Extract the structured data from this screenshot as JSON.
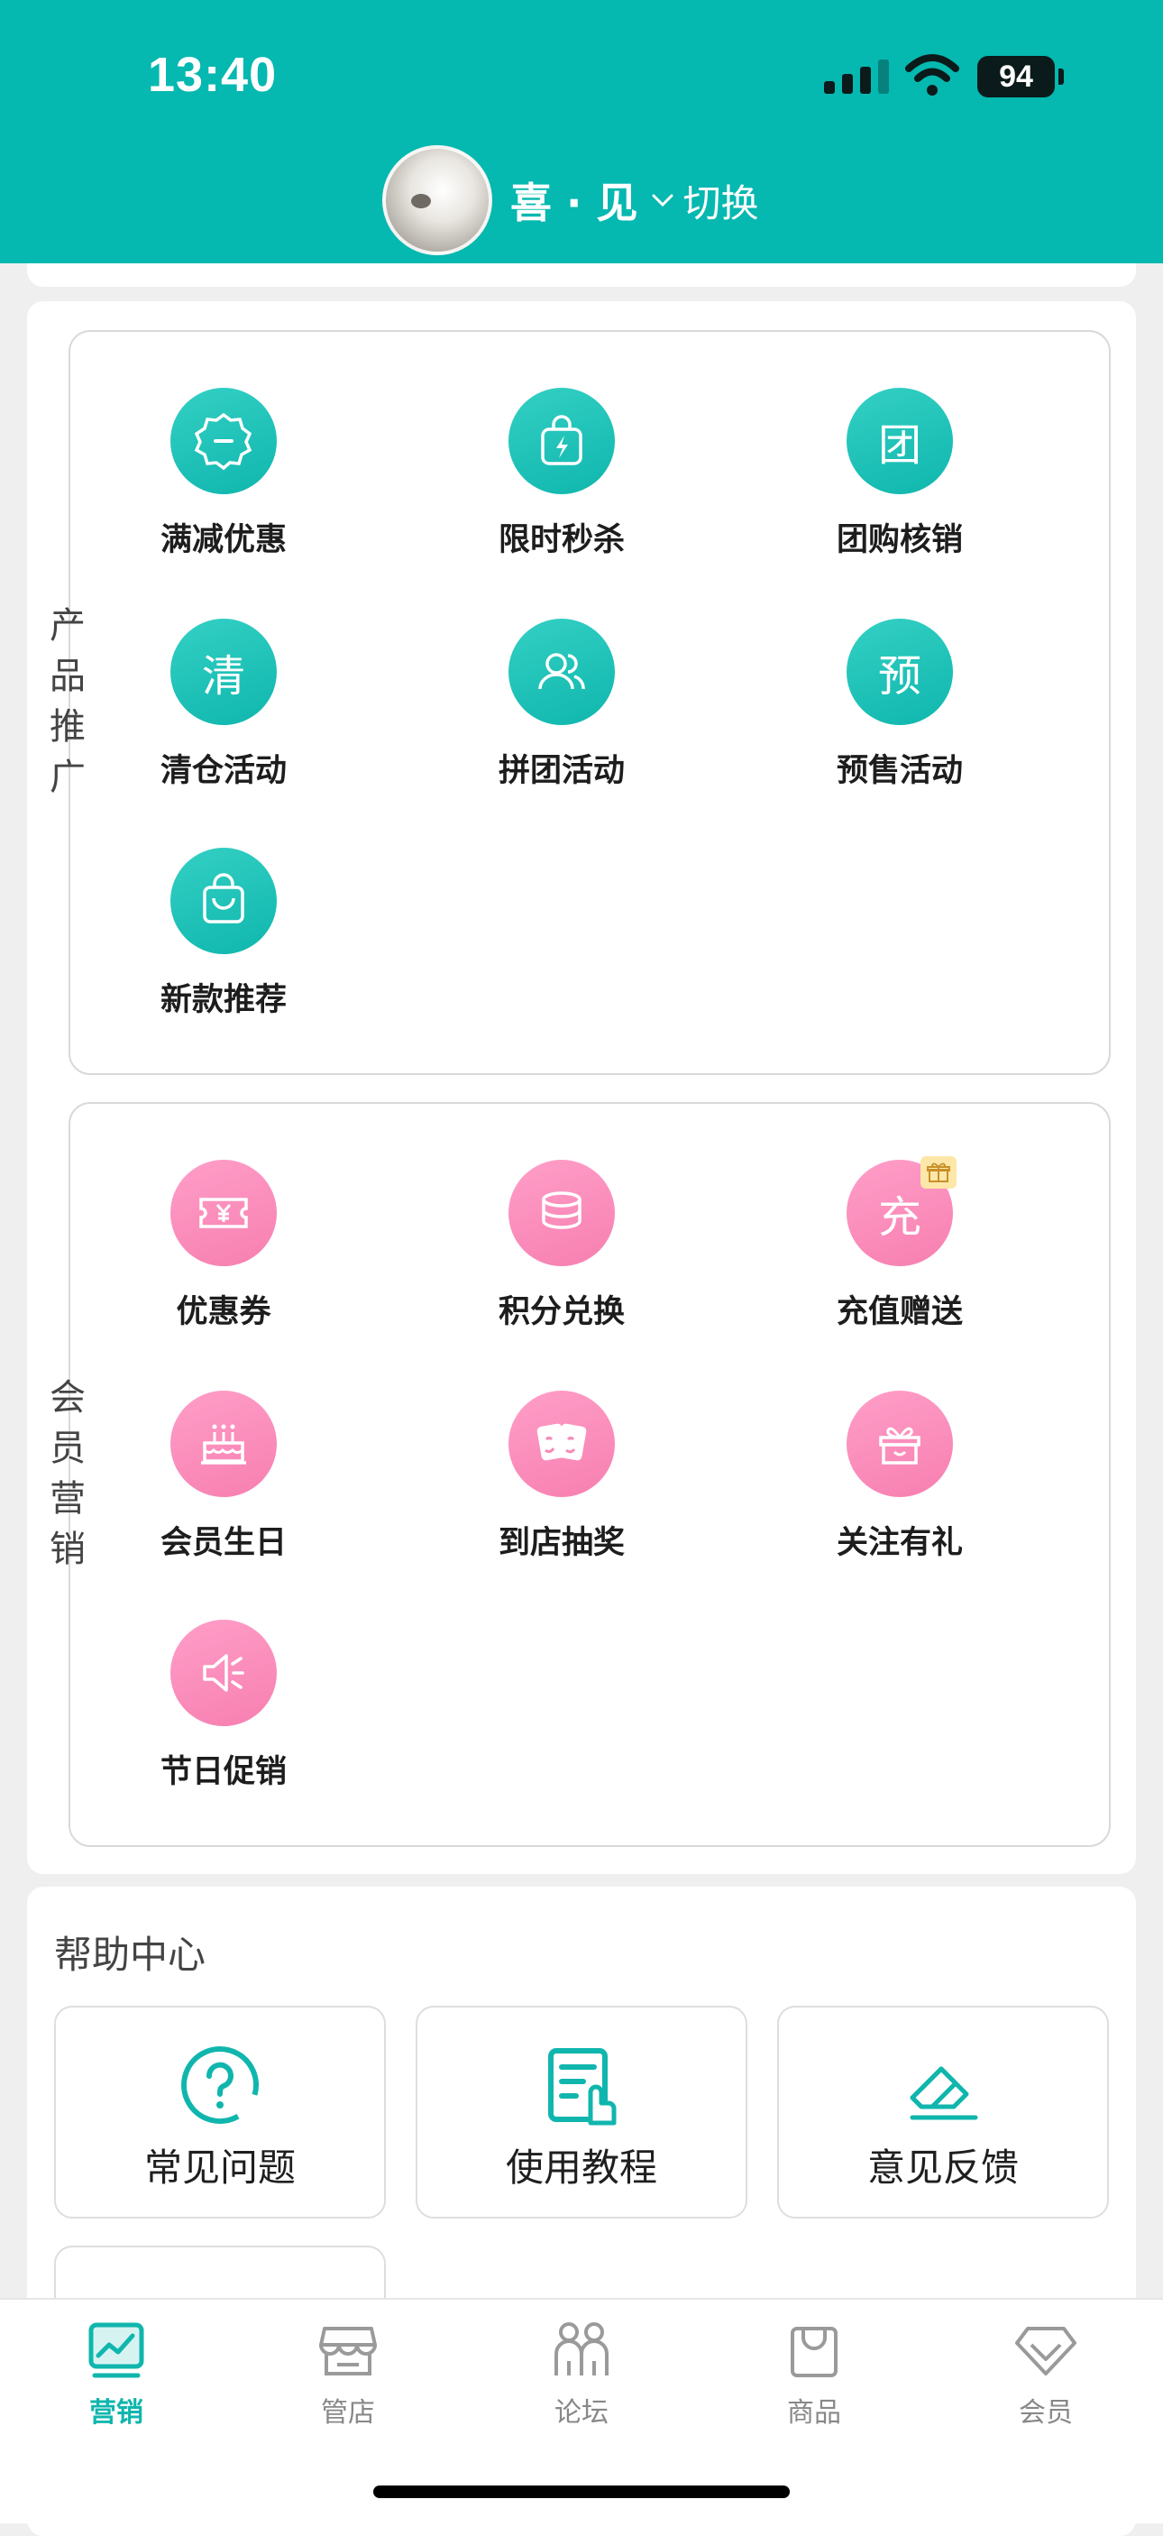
{
  "status_bar": {
    "time": "13:40",
    "battery": "94"
  },
  "header": {
    "store_name": "喜 · 见",
    "switch_label": "切换"
  },
  "groups": [
    {
      "label": "产品推广",
      "items": [
        {
          "label": "满减优惠",
          "icon": "discount-badge-icon",
          "color": "#1cbcb3"
        },
        {
          "label": "限时秒杀",
          "icon": "flash-sale-bag-icon",
          "color": "#1cbcb3"
        },
        {
          "label": "团购核销",
          "icon": "group-buy-glyph-icon",
          "glyph": "团",
          "color": "#1cbcb3"
        },
        {
          "label": "清仓活动",
          "icon": "clearance-glyph-icon",
          "glyph": "清",
          "color": "#1cbcb3"
        },
        {
          "label": "拼团活动",
          "icon": "group-users-icon",
          "color": "#1cbcb3"
        },
        {
          "label": "预售活动",
          "icon": "presale-glyph-icon",
          "glyph": "预",
          "color": "#1cbcb3"
        },
        {
          "label": "新款推荐",
          "icon": "shopping-bag-icon",
          "color": "#1cbcb3"
        }
      ]
    },
    {
      "label": "会员营销",
      "items": [
        {
          "label": "优惠券",
          "icon": "coupon-ticket-icon",
          "color": "#f88bb8"
        },
        {
          "label": "积分兑换",
          "icon": "coin-stack-icon",
          "color": "#f88bb8"
        },
        {
          "label": "充值赠送",
          "icon": "recharge-glyph-icon",
          "glyph": "充",
          "color": "#f88bb8"
        },
        {
          "label": "会员生日",
          "icon": "birthday-cake-icon",
          "color": "#f88bb8"
        },
        {
          "label": "到店抽奖",
          "icon": "lottery-cards-icon",
          "color": "#f88bb8"
        },
        {
          "label": "关注有礼",
          "icon": "gift-box-icon",
          "color": "#f88bb8"
        },
        {
          "label": "节日促销",
          "icon": "megaphone-icon",
          "color": "#f88bb8"
        }
      ]
    }
  ],
  "help": {
    "title": "帮助中心",
    "items": [
      {
        "label": "常见问题",
        "icon": "question-circle-icon"
      },
      {
        "label": "使用教程",
        "icon": "tutorial-document-icon"
      },
      {
        "label": "意见反馈",
        "icon": "feedback-eraser-icon"
      }
    ]
  },
  "tabs": [
    {
      "label": "营销",
      "icon": "marketing-chart-icon",
      "active": true
    },
    {
      "label": "管店",
      "icon": "storefront-icon",
      "active": false
    },
    {
      "label": "论坛",
      "icon": "forum-people-icon",
      "active": false
    },
    {
      "label": "商品",
      "icon": "product-bag-icon",
      "active": false
    },
    {
      "label": "会员",
      "icon": "member-diamond-icon",
      "active": false
    }
  ],
  "colors": {
    "brand_teal": "#05b8b0",
    "accent_pink": "#f88bb8",
    "active_tab": "#10b6ad"
  }
}
